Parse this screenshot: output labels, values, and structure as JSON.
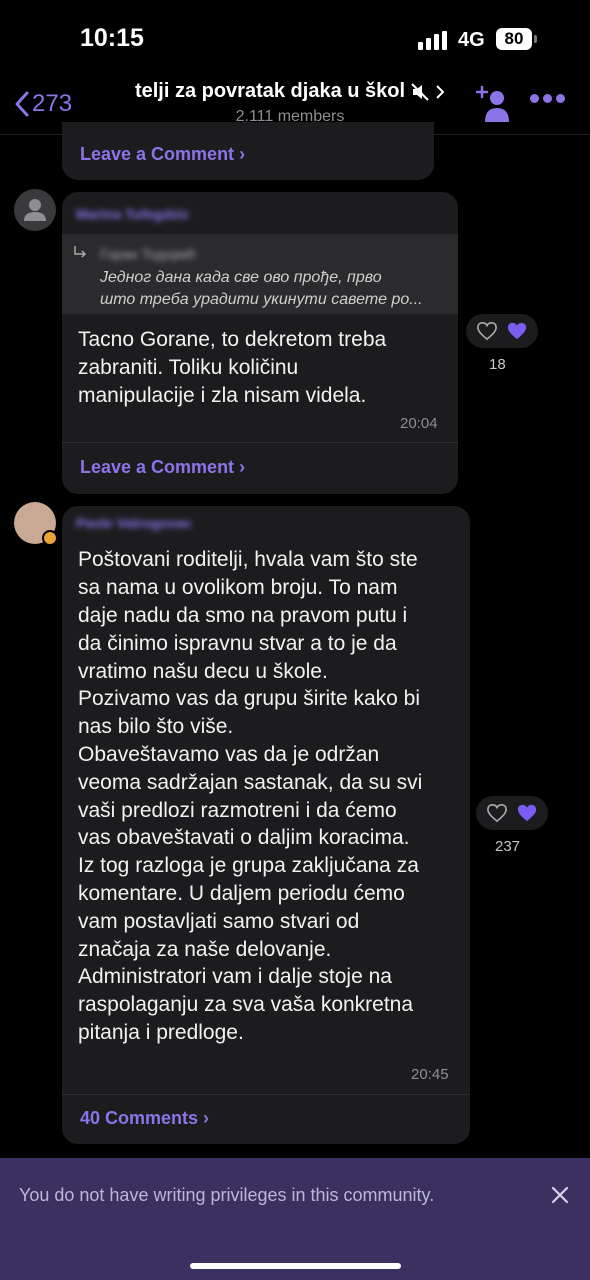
{
  "status_bar": {
    "time": "10:15",
    "network": "4G",
    "battery": "80"
  },
  "header": {
    "back_count": "273",
    "title": "telji za povratak  djaka u škol",
    "members": "2.111 members"
  },
  "posts": [
    {
      "comment_link": "Leave a Comment"
    },
    {
      "reply_text_1": "Једног дана када све ово прође, прво",
      "reply_text_2": "што треба урадити укинути савете ро...",
      "lines": [
        "Tacno Gorane, to dekretom treba",
        "zabraniti. Toliku količinu",
        "manipulacije i zla nisam videla."
      ],
      "time": "20:04",
      "reactions": "18",
      "comment_link": "Leave a Comment"
    },
    {
      "lines": [
        "Poštovani roditelji, hvala vam što ste",
        "sa nama u ovolikom broju. To nam",
        "daje nadu da smo na pravom putu i",
        "da činimo ispravnu stvar a to je da",
        "vratimo našu decu u škole.",
        "Pozivamo vas da grupu širite kako bi",
        "nas bilo što više.",
        "Obaveštavamo vas da je održan",
        "veoma sadržajan sastanak, da su svi",
        "vaši predlozi razmotreni i da ćemo",
        "vas obaveštavati o daljim koracima.",
        "Iz tog razloga je grupa zaključana za",
        "komentare. U daljem periodu ćemo",
        "vam postavljati samo stvari od",
        "značaja za naše delovanje.",
        "Administratori vam i dalje stoje na",
        "raspolaganju za sva vaša konkretna",
        "pitanja i predloge."
      ],
      "time": "20:45",
      "reactions": "237",
      "comment_link": "40 Comments"
    }
  ],
  "footer": {
    "notice": "You do not have writing privileges in this community."
  },
  "colors": {
    "accent": "#8b74e8",
    "bubble": "#1c1c1e",
    "banner": "#3a3160"
  },
  "icons": [
    "back-chevron-icon",
    "mute-icon",
    "add-member-icon",
    "more-icon",
    "heart-icon",
    "close-icon",
    "reply-arrow-icon",
    "avatar-placeholder-icon"
  ]
}
